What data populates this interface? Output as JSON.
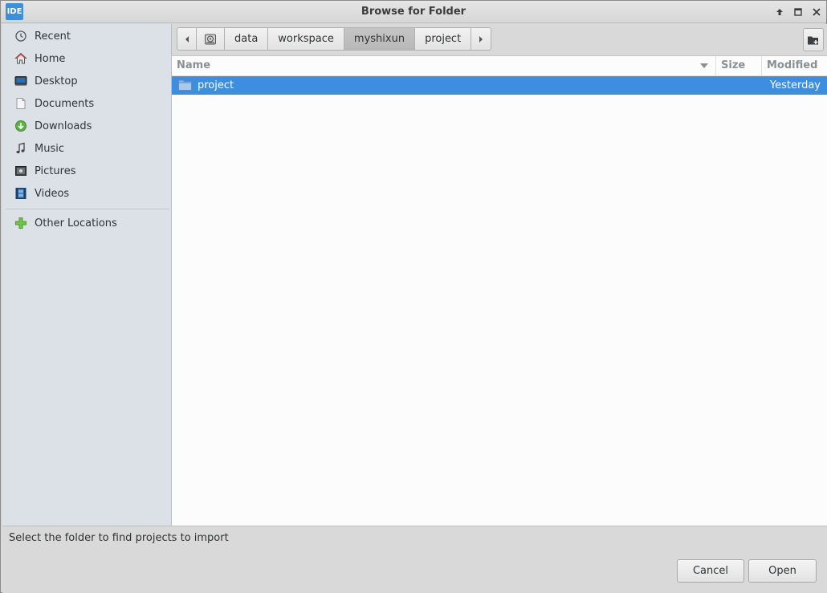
{
  "window": {
    "app_icon_text": "IDE",
    "title": "Browse for Folder"
  },
  "sidebar": {
    "items": [
      {
        "label": "Recent",
        "icon": "clock-icon"
      },
      {
        "label": "Home",
        "icon": "home-icon"
      },
      {
        "label": "Desktop",
        "icon": "desktop-icon"
      },
      {
        "label": "Documents",
        "icon": "document-icon"
      },
      {
        "label": "Downloads",
        "icon": "download-icon"
      },
      {
        "label": "Music",
        "icon": "music-icon"
      },
      {
        "label": "Pictures",
        "icon": "picture-icon"
      },
      {
        "label": "Videos",
        "icon": "video-icon"
      }
    ],
    "other": {
      "label": "Other Locations",
      "icon": "plus-icon"
    }
  },
  "pathbar": {
    "segments": [
      "data",
      "workspace",
      "myshixun",
      "project"
    ],
    "active": "myshixun"
  },
  "columns": {
    "name": "Name",
    "size": "Size",
    "modified": "Modified"
  },
  "files": [
    {
      "name": "project",
      "size": "",
      "modified": "Yesterday",
      "selected": true
    }
  ],
  "footer": {
    "status": "Select the folder to find projects to import",
    "cancel_label": "Cancel",
    "open_label": "Open"
  },
  "colors": {
    "selection": "#3d8ee0",
    "sidebar_bg": "#dbe1e6",
    "accent_icon": "#3d8fd9"
  }
}
